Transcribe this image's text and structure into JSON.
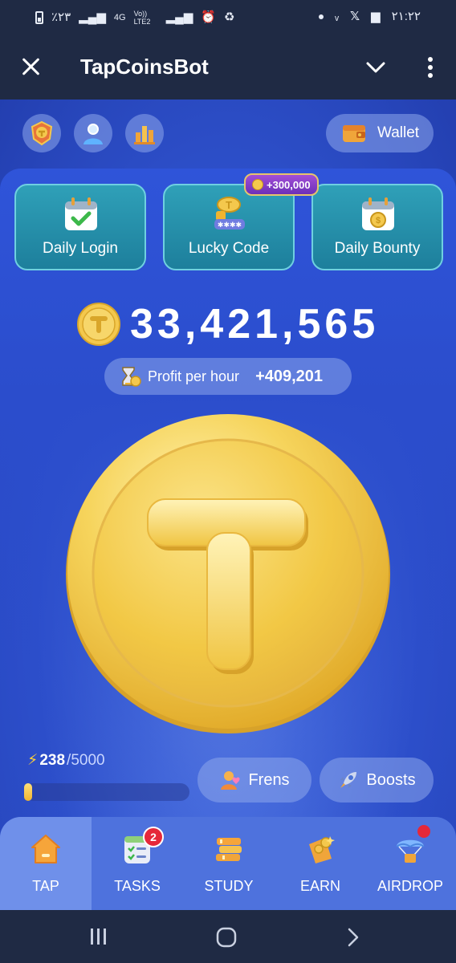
{
  "status_bar": {
    "battery_text": "٪۲۳",
    "network": "4G",
    "network_sub": "Vo)) LTE2",
    "time": "۲۱:۲۲"
  },
  "header": {
    "title": "TapCoinsBot"
  },
  "top_icons": [
    "league-icon",
    "profile-icon",
    "stats-icon"
  ],
  "wallet": {
    "label": "Wallet"
  },
  "quick_cards": [
    {
      "label": "Daily Login",
      "icon": "calendar-check-icon"
    },
    {
      "label": "Lucky Code",
      "icon": "coin-stack-icon"
    },
    {
      "label": "Daily Bounty",
      "icon": "calendar-coin-icon"
    }
  ],
  "promo_badge": "+300,000",
  "balance": "33,421,565",
  "profit": {
    "label": "Profit per hour",
    "value": "+409,201"
  },
  "energy": {
    "current": "238",
    "max": "/5000",
    "fraction": 0.048
  },
  "buttons": {
    "frens": "Frens",
    "boosts": "Boosts"
  },
  "bottom_nav": [
    {
      "label": "TAP",
      "active": true
    },
    {
      "label": "TASKS",
      "badge": "2"
    },
    {
      "label": "STUDY"
    },
    {
      "label": "EARN"
    },
    {
      "label": "AIRDROP",
      "dot": true
    }
  ],
  "colors": {
    "header_bg": "#1f2a44",
    "game_bg": "#2d4fc9",
    "coin_gold": "#f4c84d",
    "card_teal": "#2fa0b8",
    "badge_red": "#e5283a"
  }
}
